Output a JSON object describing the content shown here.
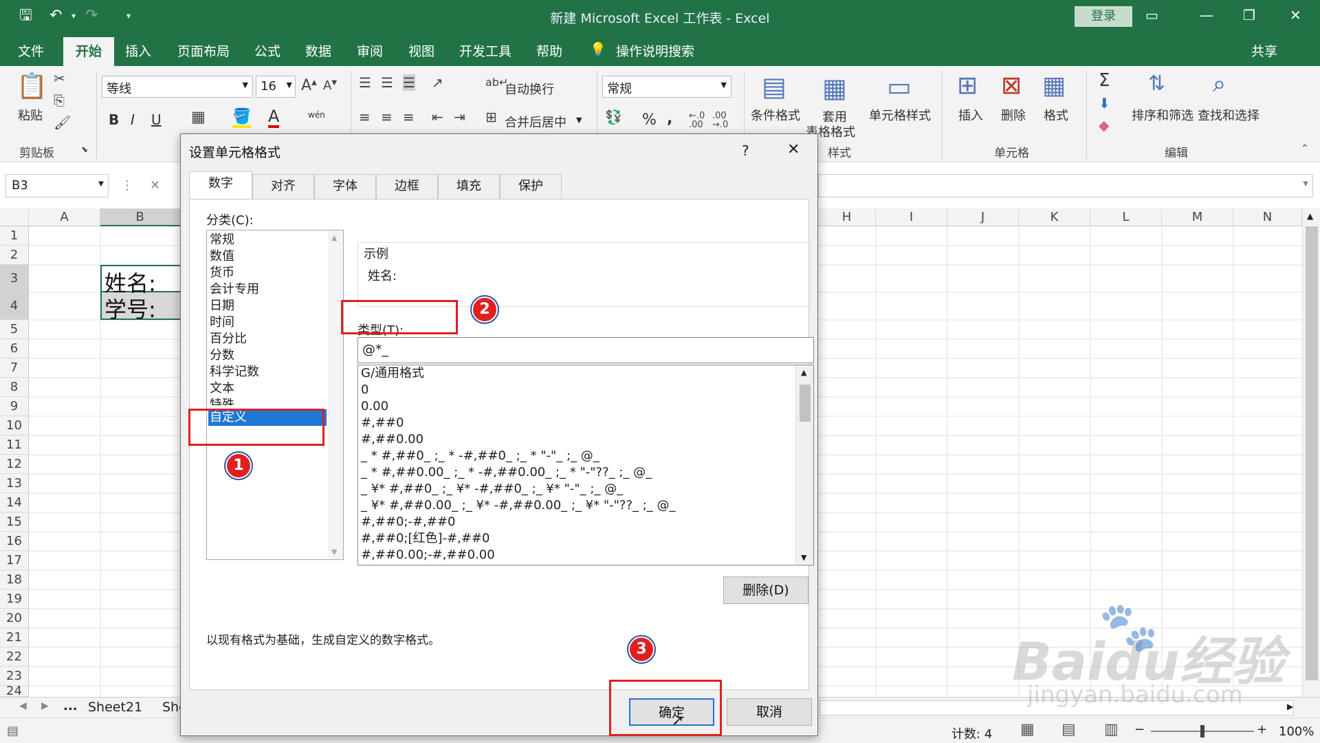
{
  "window": {
    "title": "新建 Microsoft Excel 工作表 - Excel",
    "login": "登录"
  },
  "tabs": [
    "文件",
    "开始",
    "插入",
    "页面布局",
    "公式",
    "数据",
    "审阅",
    "视图",
    "开发工具",
    "帮助"
  ],
  "tell_me": "操作说明搜索",
  "share": "共享",
  "ribbon": {
    "paste": "粘贴",
    "clipboard_group": "剪贴板",
    "font_name": "等线",
    "font_size": "16",
    "bold": "B",
    "italic": "I",
    "underline": "U",
    "wrap_text": "自动换行",
    "merge_center": "合并后居中",
    "number_format": "常规",
    "conditional_format": "条件格式",
    "table_format_1": "套用",
    "table_format_2": "表格格式",
    "cell_styles": "单元格样式",
    "styles_group": "样式",
    "insert": "插入",
    "delete": "删除",
    "format": "格式",
    "cells_group": "单元格",
    "sort_filter": "排序和筛选",
    "find_select": "查找和选择",
    "editing_group": "编辑",
    "percent": "%",
    "comma": ",",
    "sum": "Σ",
    "phonetic": "wén"
  },
  "formula_bar": {
    "name_box": "B3",
    "cancel": "✕"
  },
  "grid": {
    "left_columns": [
      "A",
      "B"
    ],
    "right_columns": [
      "H",
      "I",
      "J",
      "K",
      "L",
      "M",
      "N"
    ],
    "rows": [
      "1",
      "2",
      "3",
      "4",
      "5",
      "6",
      "7",
      "8",
      "9",
      "10",
      "11",
      "12",
      "13",
      "14",
      "15",
      "16",
      "17",
      "18",
      "19",
      "20",
      "21",
      "22",
      "23",
      "24"
    ],
    "cell_b3": "姓名:",
    "cell_b4": "学号:"
  },
  "sheets": {
    "tab1": "Sheet21",
    "tab2": "She",
    "more": "..."
  },
  "status": {
    "count": "计数: 4",
    "zoom": "100%"
  },
  "dialog": {
    "title": "设置单元格格式",
    "help": "?",
    "close": "✕",
    "tabs": [
      "数字",
      "对齐",
      "字体",
      "边框",
      "填充",
      "保护"
    ],
    "category_label": "分类(C):",
    "categories": [
      "常规",
      "数值",
      "货币",
      "会计专用",
      "日期",
      "时间",
      "百分比",
      "分数",
      "科学记数",
      "文本",
      "特殊",
      "自定义"
    ],
    "sample_label": "示例",
    "sample_value": "姓名:",
    "type_label": "类型(T):",
    "type_value": "@*_",
    "formats": [
      "G/通用格式",
      "0",
      "0.00",
      "#,##0",
      "#,##0.00",
      "_ * #,##0_ ;_ * -#,##0_ ;_ * \"-\"_ ;_ @_",
      "_ * #,##0.00_ ;_ * -#,##0.00_ ;_ * \"-\"??_ ;_ @_",
      "_ ¥* #,##0_ ;_ ¥* -#,##0_ ;_ ¥* \"-\"_ ;_ @_",
      "_ ¥* #,##0.00_ ;_ ¥* -#,##0.00_ ;_ ¥* \"-\"??_ ;_ @_",
      "#,##0;-#,##0",
      "#,##0;[红色]-#,##0",
      "#,##0.00;-#,##0.00"
    ],
    "delete_button": "删除(D)",
    "description": "以现有格式为基础，生成自定义的数字格式。",
    "ok": "确定",
    "cancel": "取消"
  },
  "annotations": [
    "1",
    "2",
    "3"
  ],
  "watermark": {
    "logo": "Baidu经验",
    "url": "jingyan.baidu.com"
  },
  "colors": {
    "excel_green": "#217346",
    "highlight_red": "#e02020",
    "selection_blue": "#1e78d6"
  }
}
